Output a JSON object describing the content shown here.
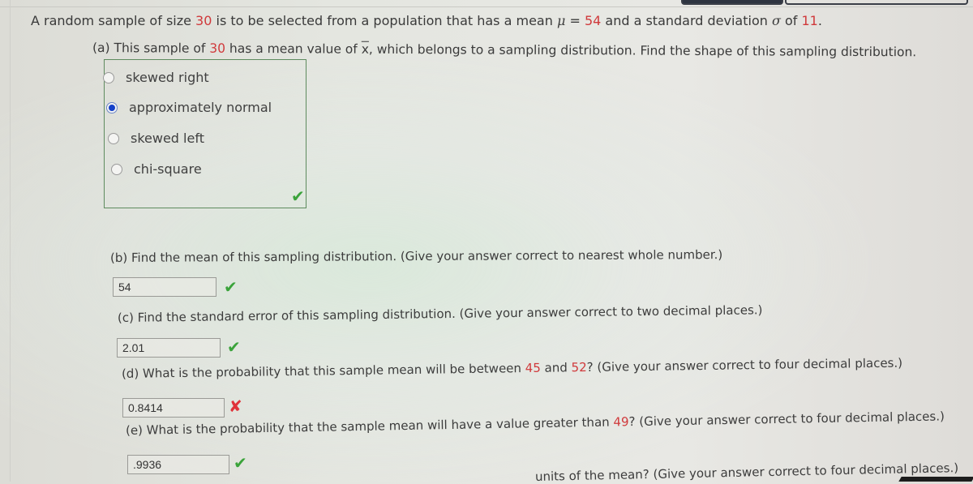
{
  "question": {
    "intro": {
      "prefix": "A random sample of size ",
      "n": "30",
      "mid1": " is to be selected from a population that has a mean ",
      "mu_symbol": "μ",
      "mid2": " = ",
      "mu": "54",
      "mid3": " and a standard deviation ",
      "sigma_symbol": "σ",
      "mid4": " of ",
      "sigma": "11",
      "suffix": "."
    },
    "part_a": {
      "prefix": "(a) This sample of ",
      "n": "30",
      "mid": " has a mean value of ",
      "xbar": "x",
      "suffix": ", which belongs to a sampling distribution. Find the shape of this sampling distribution.",
      "options": [
        {
          "label": "skewed right",
          "selected": false
        },
        {
          "label": "approximately normal",
          "selected": true
        },
        {
          "label": "skewed left",
          "selected": false
        },
        {
          "label": "chi-square",
          "selected": false
        }
      ],
      "status": "correct",
      "status_icon": "✔"
    },
    "part_b": {
      "text": "(b) Find the mean of this sampling distribution. (Give your answer correct to nearest whole number.)",
      "answer": "54",
      "status": "correct",
      "status_icon": "✔"
    },
    "part_c": {
      "text": "(c) Find the standard error of this sampling distribution. (Give your answer correct to two decimal places.)",
      "answer": "2.01",
      "status": "correct",
      "status_icon": "✔"
    },
    "part_d": {
      "prefix": "(d) What is the probability that this sample mean will be between ",
      "low": "45",
      "mid": " and ",
      "high": "52",
      "suffix": "? (Give your answer correct to four decimal places.)",
      "answer": "0.8414",
      "status": "incorrect",
      "status_icon": "✘"
    },
    "part_e": {
      "prefix": "(e) What is the probability that the sample mean will have a value greater than ",
      "value": "49",
      "suffix": "? (Give your answer correct to four decimal places.)",
      "answer": ".9936",
      "status": "correct",
      "status_icon": "✔"
    },
    "part_f_partial": {
      "text": "units of the mean? (Give your answer correct to four decimal places.)"
    }
  },
  "colors": {
    "highlight": "#d0393b",
    "correct": "#3aa33a",
    "incorrect": "#e0323a",
    "radio_selected": "#1541c9",
    "choice_border": "#5e8b5e"
  }
}
